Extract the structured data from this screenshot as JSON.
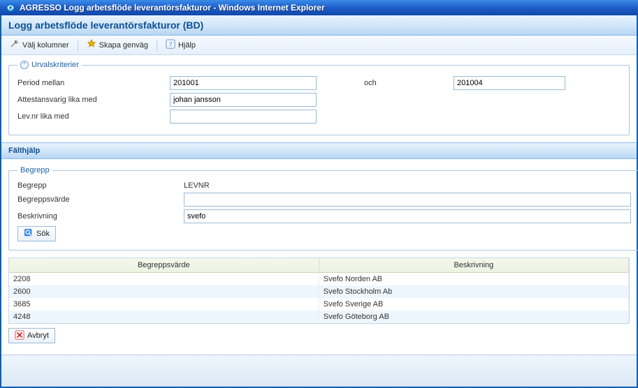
{
  "window": {
    "title": "AGRESSO Logg arbetsflöde leverantörsfakturor - Windows Internet Explorer"
  },
  "app": {
    "title": "Logg arbetsflöde leverantörsfakturor (BD)"
  },
  "toolbar": {
    "valj_kolumner": "Välj kolumner",
    "skapa_genvag": "Skapa genväg",
    "hjalp": "Hjälp"
  },
  "criteria": {
    "legend": "Urvalskriterier",
    "period_label": "Period mellan",
    "period_from": "201001",
    "and_label": "och",
    "period_to": "201004",
    "attest_label": "Attestansvarig lika med",
    "attest_value": "johan jansson",
    "levnr_label": "Lev.nr lika med",
    "levnr_value": ""
  },
  "falthjalp": {
    "header": "Fälthjälp",
    "legend": "Begrepp",
    "begrepp_label": "Begrepp",
    "begrepp_value": "LEVNR",
    "varde_label": "Begreppsvärde",
    "varde_value": "",
    "beskr_label": "Beskrivning",
    "beskr_value": "svefo",
    "sok_label": "Sök"
  },
  "results": {
    "headers": {
      "varde": "Begreppsvärde",
      "beskr": "Beskrivning"
    },
    "rows": [
      {
        "varde": "2208",
        "beskr": "Svefo Norden AB"
      },
      {
        "varde": "2600",
        "beskr": "Svefo Stockholm Ab"
      },
      {
        "varde": "3685",
        "beskr": "Svefo Sverige AB"
      },
      {
        "varde": "4248",
        "beskr": "Svefo Göteborg AB"
      }
    ]
  },
  "avbryt_label": "Avbryt"
}
